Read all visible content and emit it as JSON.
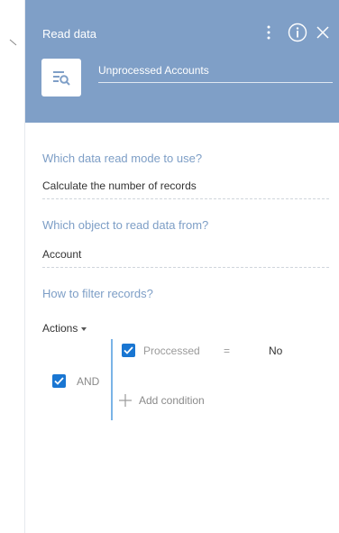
{
  "header": {
    "title": "Read data",
    "element_name": "Unprocessed Accounts",
    "accent_color": "#7f9fc7"
  },
  "icons": {
    "element": "read-data-icon",
    "menu": "kebab-menu-icon",
    "info": "info-icon",
    "close": "close-icon"
  },
  "fields": {
    "read_mode": {
      "question": "Which data read mode to use?",
      "value": "Calculate the number of records"
    },
    "object": {
      "question": "Which object to read data from?",
      "value": "Account"
    },
    "filter": {
      "question": "How to filter records?"
    }
  },
  "filter": {
    "actions_label": "Actions",
    "group_operator": "AND",
    "conditions": [
      {
        "field": "Proccessed",
        "operator": "=",
        "value": "No",
        "checked": true
      }
    ],
    "add_condition_label": "Add condition"
  },
  "colors": {
    "question": "#7d9ec6",
    "checkbox": "#1976d2",
    "group_line": "#7ab3e6"
  }
}
